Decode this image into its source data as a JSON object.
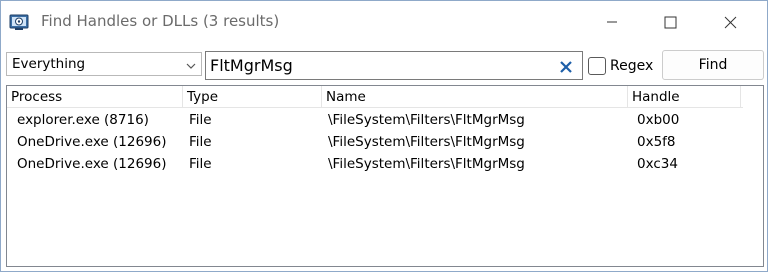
{
  "window": {
    "title": "Find Handles or DLLs (3 results)",
    "icon": "process-explorer-icon"
  },
  "toolbar": {
    "filter_value": "Everything",
    "search_value": "FltMgrMsg",
    "regex_label": "Regex",
    "regex_checked": false,
    "find_label": "Find"
  },
  "results": {
    "columns": [
      "Process",
      "Type",
      "Name",
      "Handle"
    ],
    "rows": [
      {
        "process": "explorer.exe (8716)",
        "type": "File",
        "name": "\\FileSystem\\Filters\\FltMgrMsg",
        "handle": "0xb00"
      },
      {
        "process": "OneDrive.exe (12696)",
        "type": "File",
        "name": "\\FileSystem\\Filters\\FltMgrMsg",
        "handle": "0x5f8"
      },
      {
        "process": "OneDrive.exe (12696)",
        "type": "File",
        "name": "\\FileSystem\\Filters\\FltMgrMsg",
        "handle": "0xc34"
      }
    ]
  },
  "colors": {
    "border": "#828790",
    "accent_clear": "#1d5fa8"
  }
}
